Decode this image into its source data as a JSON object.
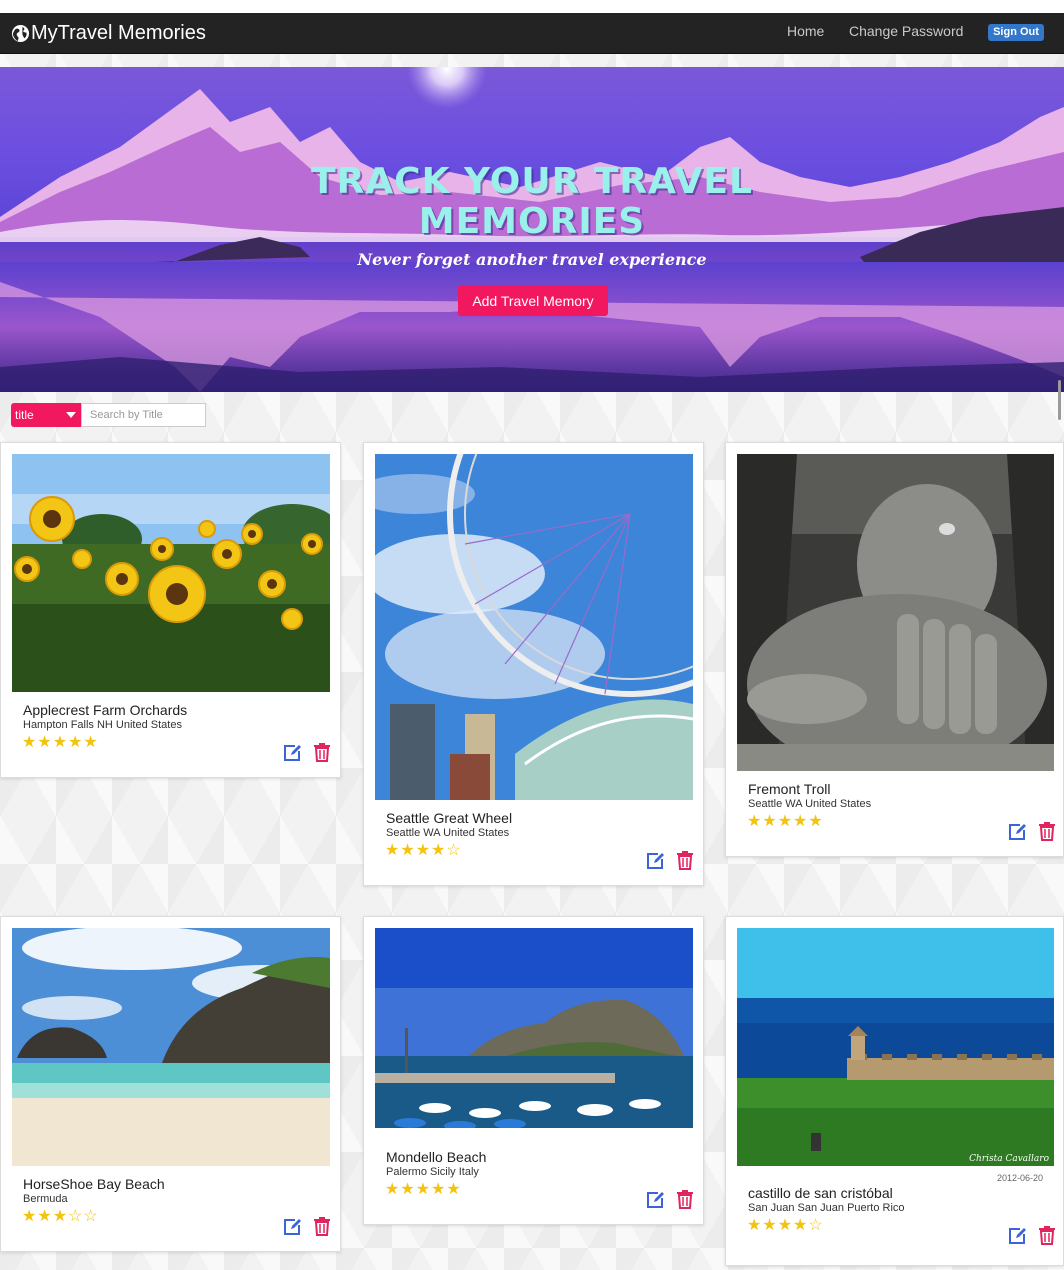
{
  "nav": {
    "brand": "MyTravel Memories",
    "links": [
      "Home",
      "Change Password"
    ],
    "signout": "Sign Out"
  },
  "hero": {
    "title_line1": "TRACK YOUR TRAVEL",
    "title_line2": "MEMORIES",
    "subtitle": "Never forget another travel experience",
    "add_button": "Add Travel Memory"
  },
  "filter": {
    "selected": "title",
    "placeholder": "Search by Title"
  },
  "memories": [
    {
      "title": "Applecrest Farm Orchards",
      "location": "Hampton Falls NH United States",
      "rating": 5,
      "stars": "★★★★★",
      "photo": "sunflowers"
    },
    {
      "title": "Seattle Great Wheel",
      "location": "Seattle WA United States",
      "rating": 4,
      "stars": "★★★★☆",
      "photo": "ferris-wheel"
    },
    {
      "title": "Fremont Troll",
      "location": "Seattle WA United States",
      "rating": 5,
      "stars": "★★★★★",
      "photo": "troll-sculpture"
    },
    {
      "title": "HorseShoe Bay Beach",
      "location": "Bermuda",
      "rating": 3,
      "stars": "★★★☆☆",
      "photo": "beach"
    },
    {
      "title": "Mondello Beach",
      "location": "Palermo Sicily Italy",
      "rating": 5,
      "stars": "★★★★★",
      "photo": "harbor-mountain"
    },
    {
      "title": "castillo de san cristóbal",
      "location": "San Juan San Juan Puerto Rico",
      "rating": 4,
      "stars": "★★★★☆",
      "photo": "fortress-coast",
      "photo_date": "2012-06-20",
      "photo_signature": "Christa Cavallaro"
    }
  ],
  "colors": {
    "navbar": "#232323",
    "accent": "#f2185f",
    "signout": "#3277c9",
    "star": "#f2c40e",
    "edit_icon": "#3a64d8",
    "delete_icon": "#e0245e",
    "hero_title": "#9af0ea"
  },
  "icons": [
    "globe-icon",
    "edit-icon",
    "trash-icon",
    "caret-down-icon"
  ]
}
